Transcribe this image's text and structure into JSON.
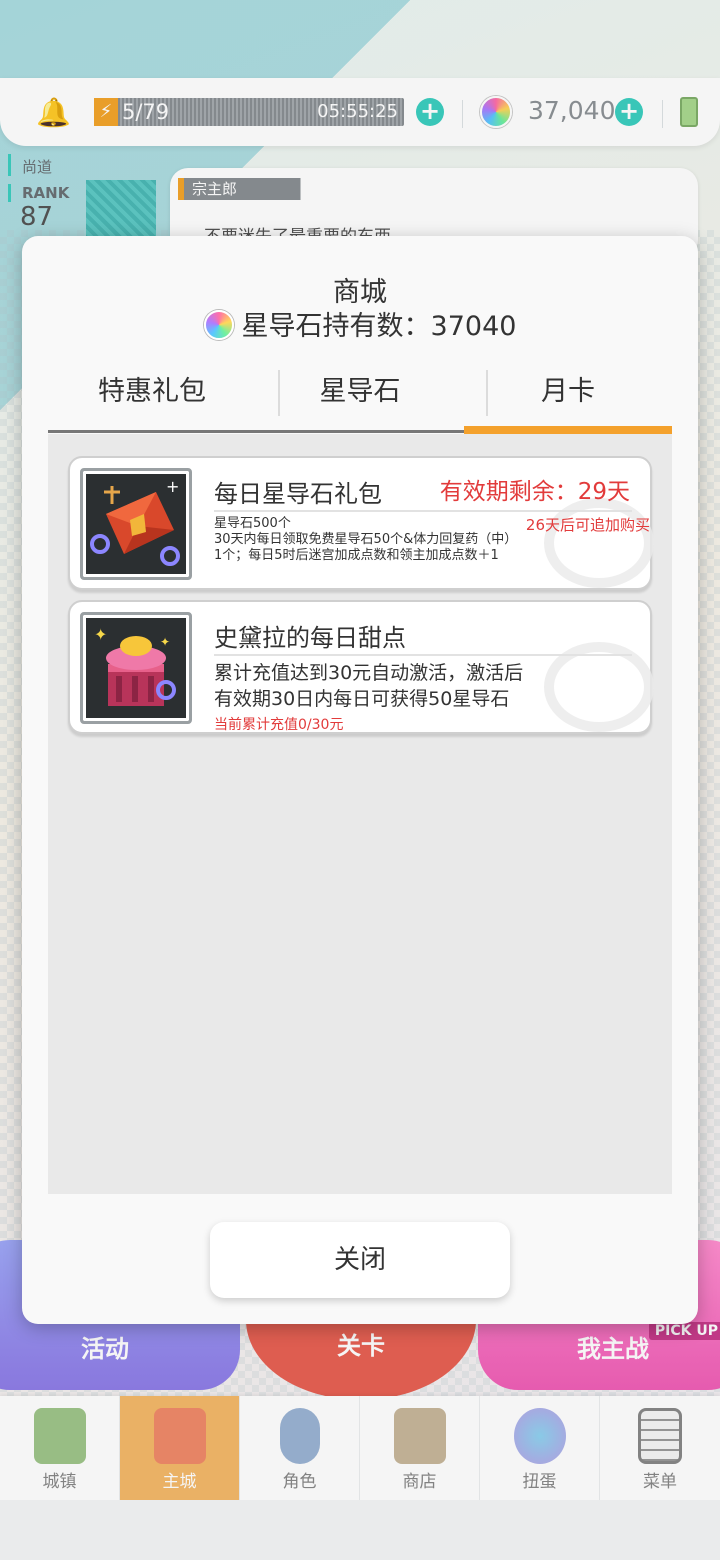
{
  "status": {
    "stamina": "5/79",
    "timer": "05:55:25",
    "gems": "37,040"
  },
  "background": {
    "player_sub": "尚道",
    "rank_label": "RANK",
    "rank_value": "87",
    "speaker": "宗主郎",
    "speech": "不要迷失了最重要的东西……",
    "btn_activity": "活动",
    "btn_stage": "关卡",
    "btn_boss": "我主战",
    "pickup": "PICK UP"
  },
  "modal": {
    "title": "商城",
    "holdings": "星导石持有数：37040",
    "tabs": [
      "特惠礼包",
      "星导石",
      "月卡"
    ],
    "active_tab": 2,
    "cards": [
      {
        "name": "每日星导石礼包",
        "validity": "有效期剩余：29天",
        "rebuy": "26天后可追加购买",
        "desc": [
          "星导石500个",
          "30天内每日领取免费星导石50个&体力回复药（中）",
          "1个；每日5时后迷宫加成点数和领主加成点数＋1"
        ],
        "icon": "red-envelope-gift-icon"
      },
      {
        "name": "史黛拉的每日甜点",
        "desc": [
          "累计充值达到30元自动激活，激活后",
          "有效期30日内每日可获得50星导石"
        ],
        "progress": "当前累计充值0/30元",
        "icon": "cupcake-icon"
      }
    ],
    "close_label": "关闭"
  },
  "nav": [
    {
      "label": "城镇",
      "icon": "town-icon"
    },
    {
      "label": "主城",
      "icon": "main-city-icon"
    },
    {
      "label": "角色",
      "icon": "character-icon"
    },
    {
      "label": "商店",
      "icon": "shop-icon"
    },
    {
      "label": "扭蛋",
      "icon": "gacha-icon"
    },
    {
      "label": "菜单",
      "icon": "menu-icon"
    }
  ],
  "nav_active": 1,
  "colors": {
    "accent_orange": "#f4a12c",
    "alert_red": "#e23b3b",
    "teal": "#3ccfc0",
    "nav_active": "#f4b96a"
  }
}
